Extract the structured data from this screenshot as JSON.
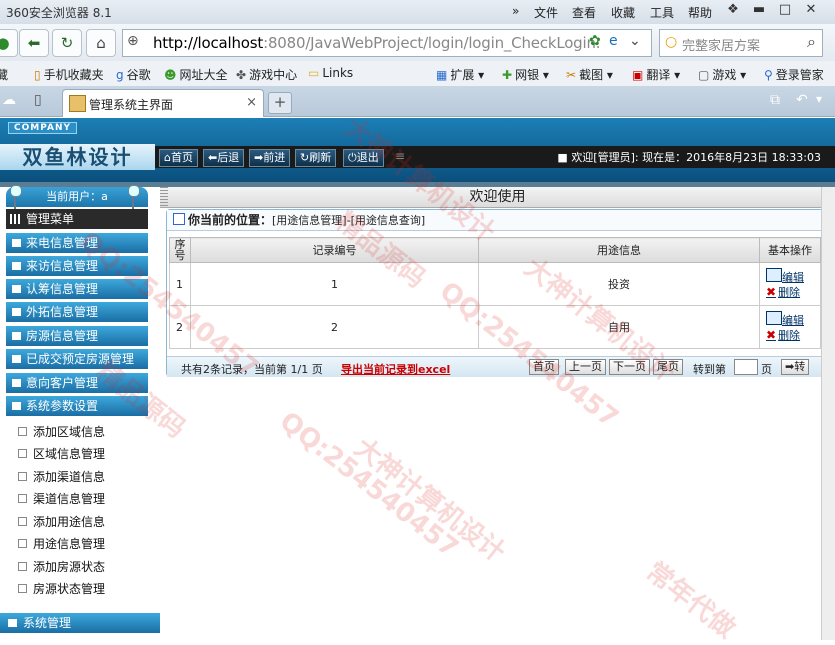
{
  "browser": {
    "title": "360安全浏览器 8.1",
    "menu": [
      "文件",
      "查看",
      "收藏",
      "工具",
      "帮助"
    ],
    "menu_arrow": "»",
    "url_host": "http://localhost",
    "url_rest": ":8080/JavaWebProject/login/login_CheckLogin.",
    "search_placeholder": "完整家居方案",
    "favorites": [
      "藏",
      "手机收藏夹",
      "谷歌",
      "网址大全",
      "游戏中心",
      "Links",
      "扩展",
      "网银",
      "截图",
      "翻译",
      "游戏",
      "登录管家"
    ],
    "tab_title": "管理系统主界面",
    "tab_close": "×",
    "new_tab": "+"
  },
  "header": {
    "company": "COMPANY",
    "brand": "双鱼林设计",
    "nav": [
      "首页",
      "后退",
      "前进",
      "刷新",
      "退出"
    ],
    "nav_icons": [
      "home-icon",
      "back-icon",
      "forward-icon",
      "refresh-icon",
      "logout-icon"
    ],
    "welcome": "欢迎[管理员]:   现在是：2016年8月23日 18:33:03"
  },
  "sidebar": {
    "current_user": "当前用户：a",
    "menu_title": "管理菜单",
    "categories": [
      "来电信息管理",
      "来访信息管理",
      "认筹信息管理",
      "外拓信息管理",
      "房源信息管理",
      "已成交预定房源管理",
      "意向客户管理",
      "系统参数设置"
    ],
    "sub_items": [
      "添加区域信息",
      "区域信息管理",
      "添加渠道信息",
      "渠道信息管理",
      "添加用途信息",
      "用途信息管理",
      "添加房源状态",
      "房源状态管理"
    ],
    "bottom": "系统管理"
  },
  "main": {
    "title": "欢迎使用",
    "location_label": "你当前的位置：",
    "location_path": "[用途信息管理]-[用途信息查询]",
    "columns": [
      "序号",
      "记录编号",
      "用途信息",
      "基本操作"
    ],
    "rows": [
      {
        "seq": "1",
        "id": "1",
        "purpose": "投资"
      },
      {
        "seq": "2",
        "id": "2",
        "purpose": "自用"
      }
    ],
    "edit_label": "编辑",
    "delete_label": "删除",
    "pager": {
      "info": "共有2条记录，当前第 1/1 页",
      "export": "导出当前记录到excel",
      "first": "首页",
      "prev": "上一页",
      "next": "下一页",
      "last": "尾页",
      "goto": "转到第",
      "page_unit": "页",
      "go": "➡转"
    }
  },
  "watermark": [
    "QQ:254540457",
    "大神计算机设计",
    "精品源码",
    "常年代做"
  ],
  "colors": {
    "accent": "#1d76aa",
    "header_dark": "#0a4f7c",
    "export_red": "#cc0000"
  }
}
